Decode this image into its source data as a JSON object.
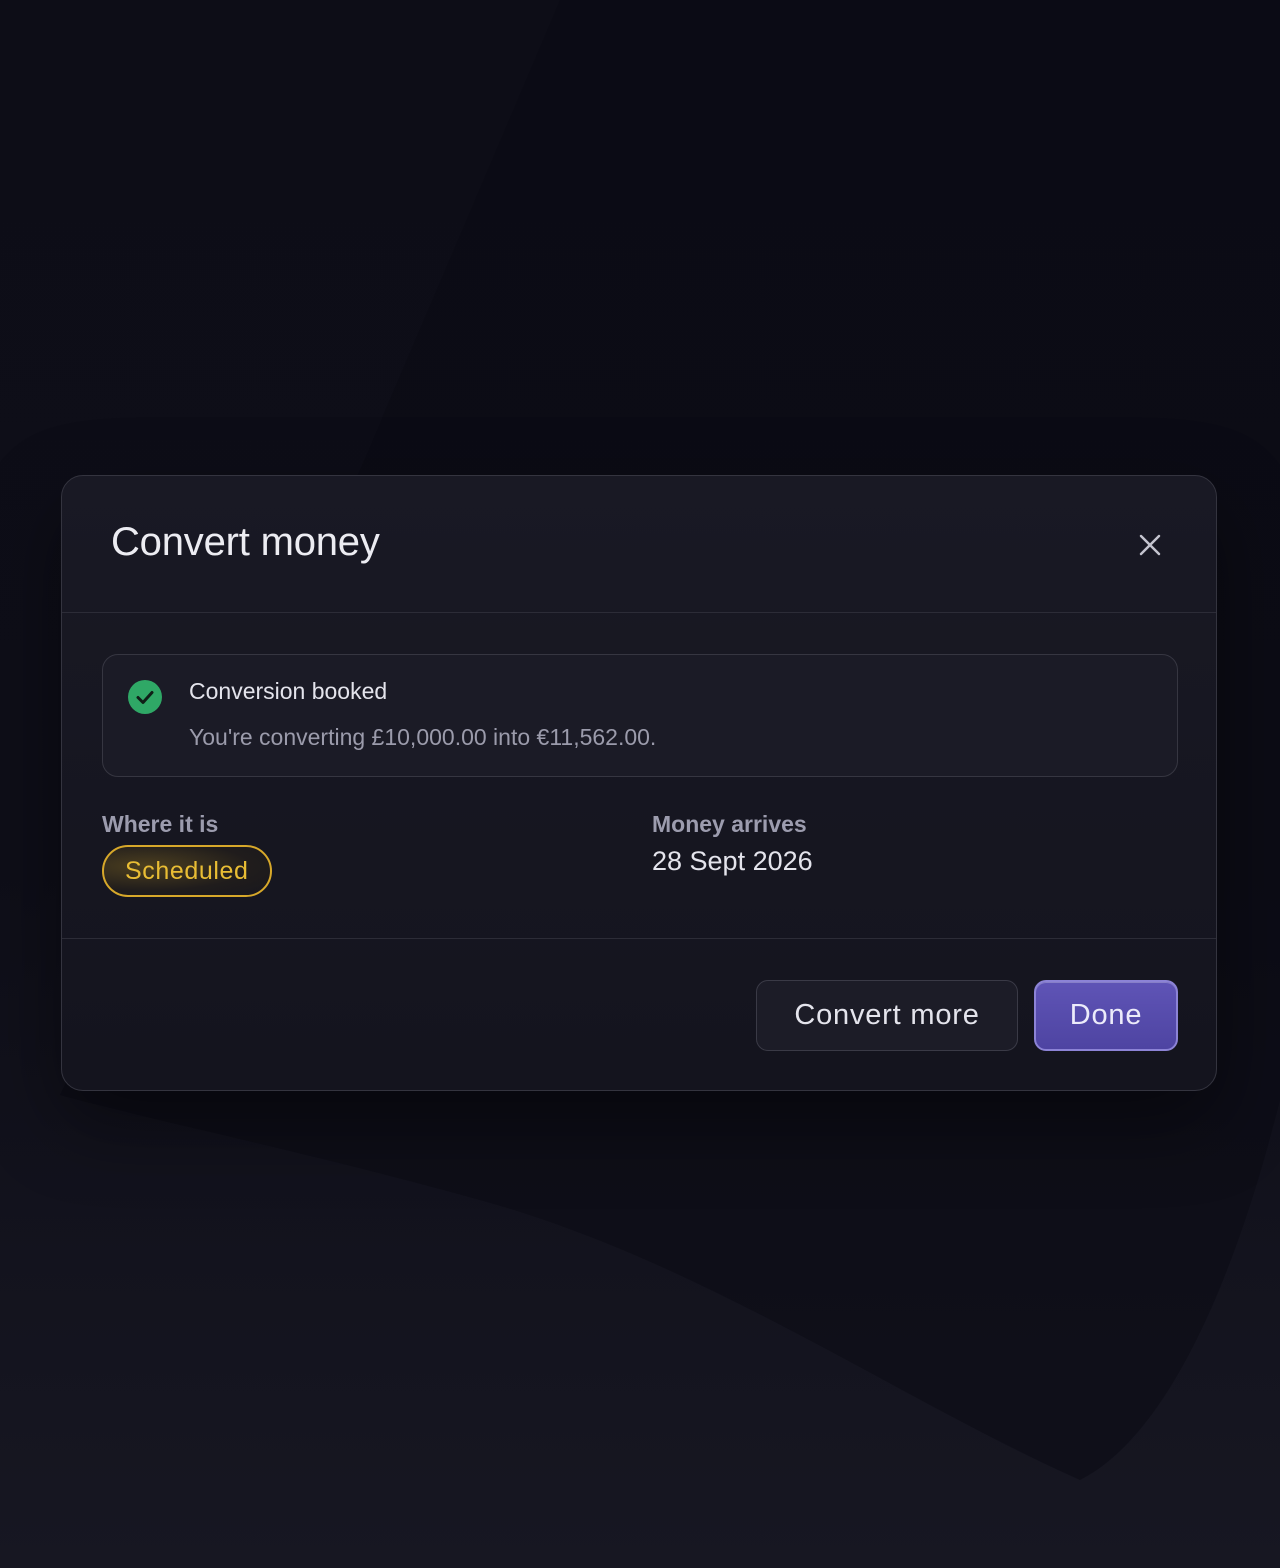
{
  "modal": {
    "title": "Convert money",
    "close_icon": "close-icon"
  },
  "alert": {
    "icon": "check-circle-icon",
    "icon_color": "#2fa866",
    "title": "Conversion booked",
    "message": "You're converting £10,000.00 into €11,562.00."
  },
  "details": {
    "status_label": "Where it is",
    "status_value": "Scheduled",
    "status_color": "#e9bd34",
    "arrival_label": "Money arrives",
    "arrival_value": "28 Sept 2026"
  },
  "footer": {
    "secondary_label": "Convert more",
    "primary_label": "Done",
    "primary_color": "#5b51b0"
  }
}
